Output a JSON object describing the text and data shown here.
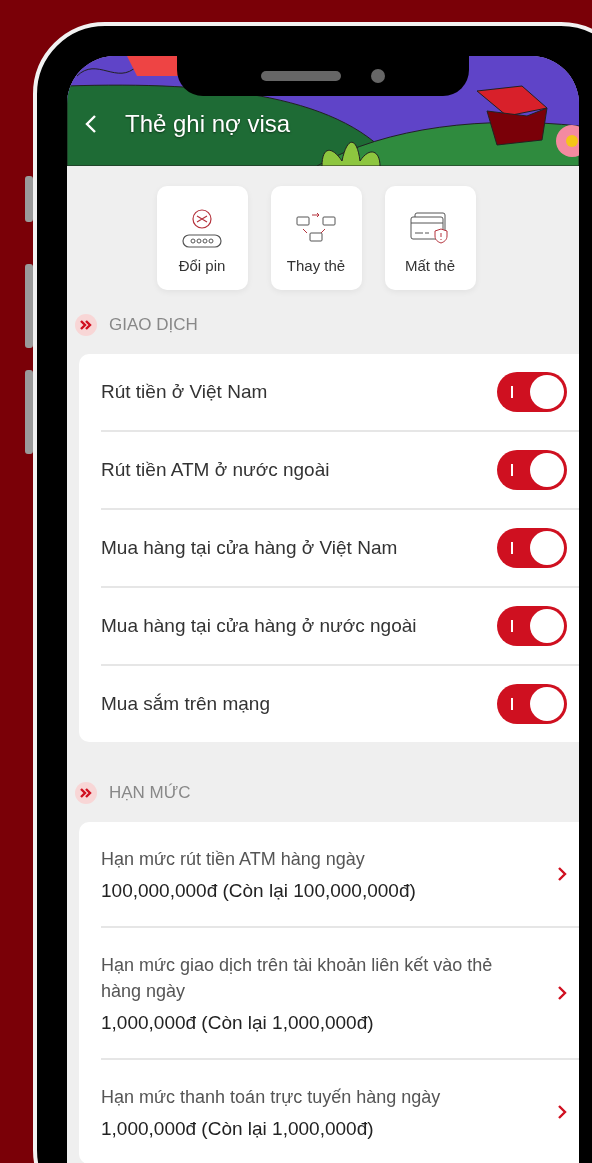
{
  "header": {
    "title": "Thẻ ghi nợ visa"
  },
  "actions": [
    {
      "label": "Đổi pin",
      "kind": "pin"
    },
    {
      "label": "Thay thẻ",
      "kind": "replace"
    },
    {
      "label": "Mất thẻ",
      "kind": "lost"
    }
  ],
  "transactions": {
    "title": "GIAO DỊCH",
    "items": [
      {
        "label": "Rút tiền ở Việt Nam",
        "on": true
      },
      {
        "label": "Rút tiền ATM ở nước ngoài",
        "on": true
      },
      {
        "label": "Mua hàng tại cửa hàng ở Việt Nam",
        "on": true
      },
      {
        "label": "Mua hàng tại cửa hàng ở nước ngoài",
        "on": true
      },
      {
        "label": "Mua sắm trên mạng",
        "on": true
      }
    ]
  },
  "limits": {
    "title": "HẠN MỨC",
    "items": [
      {
        "label": "Hạn mức rút tiền ATM hàng ngày",
        "value": "100,000,000đ (Còn lại 100,000,000đ)"
      },
      {
        "label": "Hạn mức giao dịch trên tài khoản liên kết vào thẻ hàng ngày",
        "value": "1,000,000đ (Còn lại 1,000,000đ)"
      },
      {
        "label": "Hạn mức thanh toán trực tuyến hàng ngày",
        "value": "1,000,000đ (Còn lại 1,000,000đ)"
      }
    ]
  }
}
